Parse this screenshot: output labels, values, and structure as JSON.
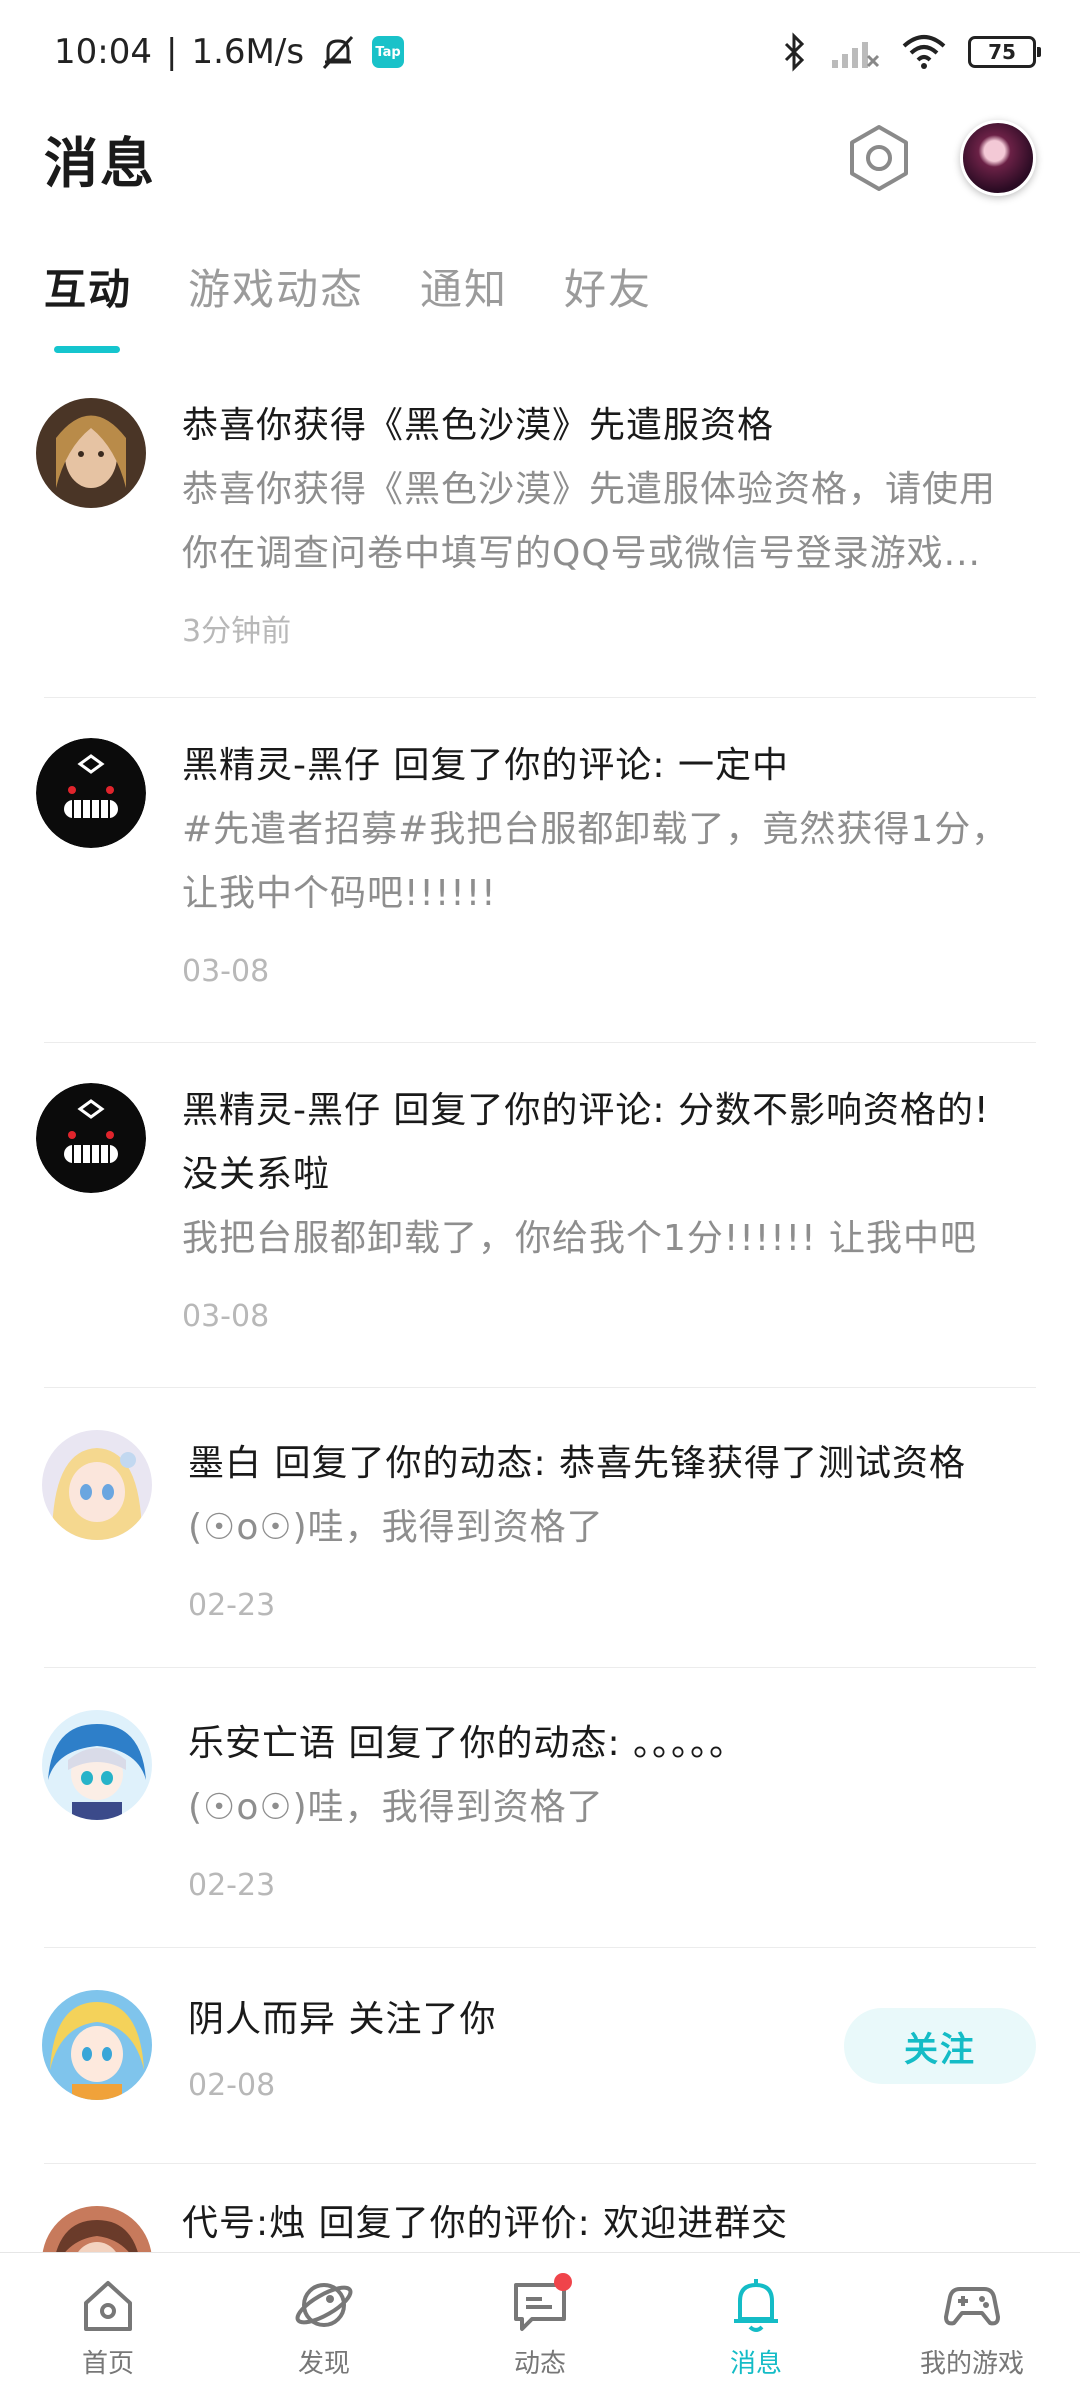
{
  "status_bar": {
    "time": "10:04",
    "speed": "1.6M/s",
    "tap_badge": "Tap",
    "battery": "75"
  },
  "header": {
    "title": "消息"
  },
  "tabs": [
    {
      "label": "互动",
      "active": true
    },
    {
      "label": "游戏动态",
      "active": false
    },
    {
      "label": "通知",
      "active": false
    },
    {
      "label": "好友",
      "active": false
    }
  ],
  "messages": [
    {
      "title": "恭喜你获得《黑色沙漠》先遣服资格",
      "content": "恭喜你获得《黑色沙漠》先遣服体验资格，请使用你在调查问卷中填写的QQ号或微信号登录游戏...",
      "time": "3分钟前"
    },
    {
      "title": "黑精灵-黑仔 回复了你的评论: 一定中",
      "content": "#先遣者招募#我把台服都卸载了，竟然获得1分，让我中个码吧!!!!!!",
      "time": "03-08"
    },
    {
      "title": "黑精灵-黑仔 回复了你的评论: 分数不影响资格的! 没关系啦",
      "content": "我把台服都卸载了，你给我个1分!!!!!! 让我中吧",
      "time": "03-08"
    },
    {
      "title": "墨白 回复了你的动态: 恭喜先锋获得了测试资格",
      "content": "(☉o☉)哇，我得到资格了",
      "time": "02-23"
    },
    {
      "title": "乐安亡语 回复了你的动态: 。。。。。",
      "content": "(☉o☉)哇，我得到资格了",
      "time": "02-23"
    },
    {
      "title": "阴人而异 关注了你",
      "time": "02-08",
      "follow_label": "关注"
    },
    {
      "title": "代号:烛 回复了你的评价: 欢迎进群交"
    }
  ],
  "bottom_nav": [
    {
      "label": "首页",
      "icon": "home-icon"
    },
    {
      "label": "发现",
      "icon": "discover-icon"
    },
    {
      "label": "动态",
      "icon": "feed-icon",
      "badge": true
    },
    {
      "label": "消息",
      "icon": "bell-icon",
      "active": true
    },
    {
      "label": "我的游戏",
      "icon": "gamepad-icon"
    }
  ],
  "colors": {
    "accent": "#14bcc6",
    "badge": "#f0444a"
  }
}
